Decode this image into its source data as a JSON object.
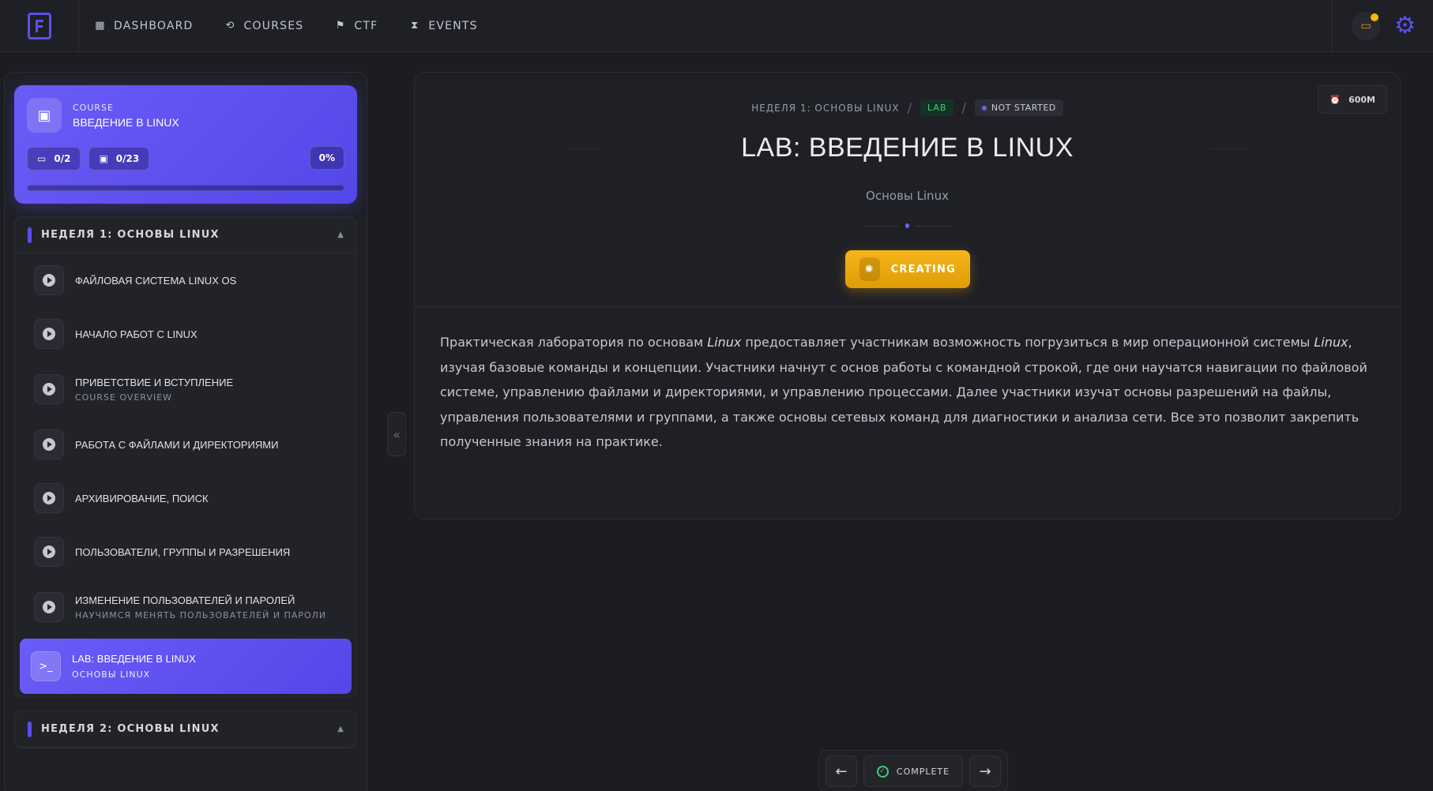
{
  "nav": {
    "items": [
      {
        "label": "DASHBOARD",
        "icon": "grid-icon"
      },
      {
        "label": "COURSES",
        "icon": "history-icon"
      },
      {
        "label": "CTF",
        "icon": "flag-icon"
      },
      {
        "label": "EVENTS",
        "icon": "hourglass-icon"
      }
    ]
  },
  "course": {
    "eyebrow": "COURSE",
    "title": "ВВЕДЕНИЕ В LINUX",
    "labs_count": "0/2",
    "lessons_count": "0/23",
    "percent": "0%",
    "progress": 0
  },
  "sections": [
    {
      "title": "НЕДЕЛЯ 1: ОСНОВЫ LINUX",
      "lessons": [
        {
          "title": "ФАЙЛОВАЯ СИСТЕМА LINUX OS",
          "sub": ""
        },
        {
          "title": "НАЧАЛО РАБОТ С LINUX",
          "sub": ""
        },
        {
          "title": "ПРИВЕТСТВИЕ И ВСТУПЛЕНИЕ",
          "sub": "COURSE OVERVIEW"
        },
        {
          "title": "РАБОТА С ФАЙЛАМИ И ДИРЕКТОРИЯМИ",
          "sub": ""
        },
        {
          "title": "АРХИВИРОВАНИЕ, ПОИСК",
          "sub": ""
        },
        {
          "title": "ПОЛЬЗОВАТЕЛИ, ГРУППЫ И РАЗРЕШЕНИЯ",
          "sub": ""
        },
        {
          "title": "ИЗМЕНЕНИЕ ПОЛЬЗОВАТЕЛЕЙ И ПАРОЛЕЙ",
          "sub": "НАУЧИМСЯ МЕНЯТЬ ПОЛЬЗОВАТЕЛЕЙ И ПАРОЛИ"
        },
        {
          "title": "LAB: ВВЕДЕНИЕ В LINUX",
          "sub": "ОСНОВЫ LINUX"
        }
      ]
    },
    {
      "title": "НЕДЕЛЯ 2: ОСНОВЫ LINUX"
    }
  ],
  "lab": {
    "breadcrumb_week": "НЕДЕЛЯ 1: ОСНОВЫ LINUX",
    "breadcrumb_sep": "/",
    "tag": "LAB",
    "status": "NOT STARTED",
    "timer": "600M",
    "title": "LAB: ВВЕДЕНИЕ В LINUX",
    "subtitle": "Основы Linux",
    "button": "CREATING",
    "desc_1": "Практическая лаборатория по основам ",
    "desc_linux1": "Linux",
    "desc_2": " предоставляет участникам возможность погрузиться в мир операционной системы ",
    "desc_linux2": "Linux",
    "desc_3": ", изучая базовые команды и концепции. Участники начнут с основ работы с командной строкой, где они научатся навигации по файловой системе, управлению файлами и директориями, и управлению процессами. Далее участники изучат основы разрешений на файлы, управления пользователями и группами, а также основы сетевых команд для диагностики и анализа сети. Все это позволит закрепить полученные знания на практике."
  },
  "bottom_nav": {
    "prev": "←",
    "complete": "COMPLETE",
    "next": "→"
  },
  "colors": {
    "accent": "#5b4ff0",
    "warning": "#f4b51a",
    "success": "#3ecf7c",
    "background": "#1c1d22"
  }
}
